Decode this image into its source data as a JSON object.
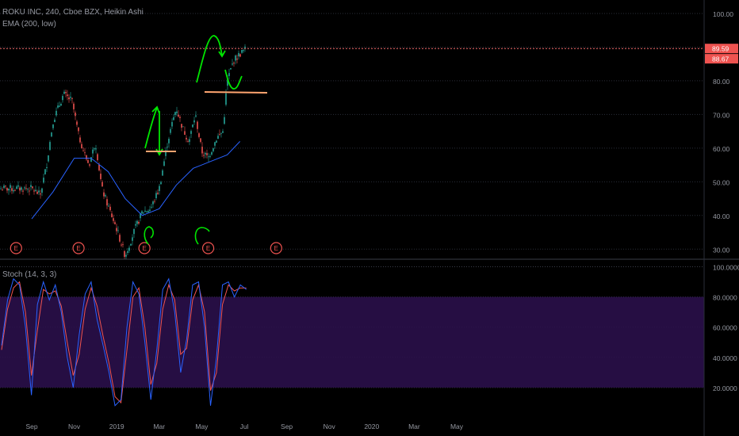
{
  "header": {
    "symbol_line": "ROKU INC, 240, Cboe BZX, Heikin Ashi",
    "ema_label": "EMA (200, low)",
    "stoch_label": "Stoch (14, 3, 3)"
  },
  "colors": {
    "background": "#000000",
    "grid": "#2a2e39",
    "candle_up": "#26a69a",
    "candle_down": "#ef5350",
    "ema_line": "#2962ff",
    "price_line": "#f06a6a",
    "price_badge": "#ef5350",
    "stoch_k": "#2962ff",
    "stoch_d": "#ef5350",
    "stoch_band": "#2a0f4a",
    "annotation_green": "#00e600",
    "annotation_orange": "#ffa570"
  },
  "chart_data": [
    {
      "type": "candlestick",
      "ylim": [
        27,
        104
      ],
      "y_ticks": [
        "100.00",
        "90.00",
        "80.00",
        "70.00",
        "60.00",
        "50.00",
        "40.00",
        "30.00"
      ],
      "x_ticks": [
        "Sep",
        "Nov",
        "2019",
        "Mar",
        "May",
        "Jul",
        "Sep",
        "Nov",
        "2020",
        "Mar",
        "May"
      ],
      "price_series": [
        {
          "x": 0,
          "y": 48
        },
        {
          "x": 0.2,
          "y": 46
        },
        {
          "x": 0.35,
          "y": 55
        },
        {
          "x": 0.5,
          "y": 68
        },
        {
          "x": 0.75,
          "y": 76
        },
        {
          "x": 0.95,
          "y": 74
        },
        {
          "x": 1.1,
          "y": 64
        },
        {
          "x": 1.25,
          "y": 58
        },
        {
          "x": 1.35,
          "y": 55
        },
        {
          "x": 1.5,
          "y": 62
        },
        {
          "x": 1.65,
          "y": 48
        },
        {
          "x": 1.85,
          "y": 41
        },
        {
          "x": 2.0,
          "y": 36
        },
        {
          "x": 2.2,
          "y": 28
        },
        {
          "x": 2.4,
          "y": 35
        },
        {
          "x": 2.6,
          "y": 41
        },
        {
          "x": 2.8,
          "y": 42
        },
        {
          "x": 3.0,
          "y": 48
        },
        {
          "x": 3.2,
          "y": 62
        },
        {
          "x": 3.4,
          "y": 72
        },
        {
          "x": 3.55,
          "y": 66
        },
        {
          "x": 3.7,
          "y": 62
        },
        {
          "x": 3.85,
          "y": 70
        },
        {
          "x": 4.0,
          "y": 59
        },
        {
          "x": 4.15,
          "y": 57
        },
        {
          "x": 4.35,
          "y": 63
        },
        {
          "x": 4.5,
          "y": 65
        },
        {
          "x": 4.6,
          "y": 80
        },
        {
          "x": 4.75,
          "y": 86
        },
        {
          "x": 4.9,
          "y": 88
        },
        {
          "x": 5.05,
          "y": 89.6
        }
      ],
      "ema_series": [
        {
          "x": 0,
          "y": 39
        },
        {
          "x": 0.5,
          "y": 47
        },
        {
          "x": 1.0,
          "y": 57
        },
        {
          "x": 1.4,
          "y": 57
        },
        {
          "x": 1.8,
          "y": 53
        },
        {
          "x": 2.2,
          "y": 45
        },
        {
          "x": 2.6,
          "y": 40
        },
        {
          "x": 3.0,
          "y": 42
        },
        {
          "x": 3.4,
          "y": 49
        },
        {
          "x": 3.8,
          "y": 54
        },
        {
          "x": 4.2,
          "y": 56
        },
        {
          "x": 4.6,
          "y": 58
        },
        {
          "x": 4.9,
          "y": 62
        }
      ],
      "price_labels": [
        {
          "value": 89.59,
          "text": "89.59"
        },
        {
          "value": 88.67,
          "text": "88.67"
        }
      ],
      "earnings_markers": [
        {
          "x": 0.08,
          "label": "E"
        },
        {
          "x": 1.55,
          "label": "E"
        },
        {
          "x": 3.1,
          "label": "E"
        },
        {
          "x": 4.6,
          "label": "E"
        },
        {
          "x": 6.2,
          "label": "E"
        }
      ]
    },
    {
      "type": "line",
      "ylim": [
        0,
        105
      ],
      "y_ticks": [
        "100.0000",
        "80.0000",
        "60.0000",
        "40.0000",
        "20.0000"
      ],
      "band": [
        20,
        80
      ],
      "series": [
        {
          "values": [
            48,
            78,
            92,
            88,
            60,
            15,
            75,
            90,
            78,
            88,
            70,
            40,
            20,
            55,
            82,
            90,
            65,
            48,
            30,
            8,
            12,
            60,
            90,
            82,
            50,
            12,
            45,
            85,
            92,
            70,
            30,
            52,
            88,
            90,
            60,
            8,
            40,
            88,
            90,
            80,
            88,
            85
          ]
        },
        {
          "values": [
            45,
            72,
            86,
            90,
            70,
            28,
            58,
            85,
            82,
            84,
            74,
            50,
            28,
            42,
            72,
            86,
            74,
            54,
            36,
            14,
            10,
            45,
            80,
            86,
            60,
            22,
            36,
            72,
            88,
            78,
            42,
            46,
            78,
            88,
            70,
            18,
            30,
            75,
            88,
            84,
            86,
            86
          ]
        }
      ]
    }
  ]
}
